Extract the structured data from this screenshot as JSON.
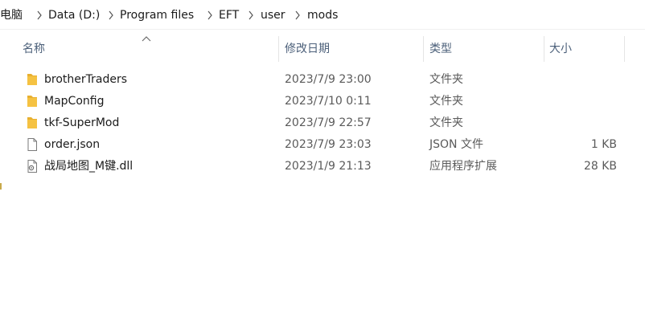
{
  "breadcrumb": {
    "items": [
      "此电脑",
      "Data (D:)",
      "Program files",
      "EFT",
      "user",
      "mods"
    ]
  },
  "columns": {
    "name": "名称",
    "date": "修改日期",
    "type": "类型",
    "size": "大小"
  },
  "files": [
    {
      "icon": "folder-icon",
      "name": "brotherTraders",
      "date": "2023/7/9 23:00",
      "type": "文件夹",
      "size": ""
    },
    {
      "icon": "folder-icon",
      "name": "MapConfig",
      "date": "2023/7/10 0:11",
      "type": "文件夹",
      "size": ""
    },
    {
      "icon": "folder-icon",
      "name": "tkf-SuperMod",
      "date": "2023/7/9 22:57",
      "type": "文件夹",
      "size": ""
    },
    {
      "icon": "file-icon",
      "name": "order.json",
      "date": "2023/7/9 23:03",
      "type": "JSON 文件",
      "size": "1 KB"
    },
    {
      "icon": "dll-file-icon",
      "name": "战局地图_M键.dll",
      "date": "2023/1/9 21:13",
      "type": "应用程序扩展",
      "size": "28 KB"
    }
  ],
  "colors": {
    "folder": "#f5c242",
    "header_text": "#4c607a",
    "secondary_text": "#5a5a5a"
  }
}
